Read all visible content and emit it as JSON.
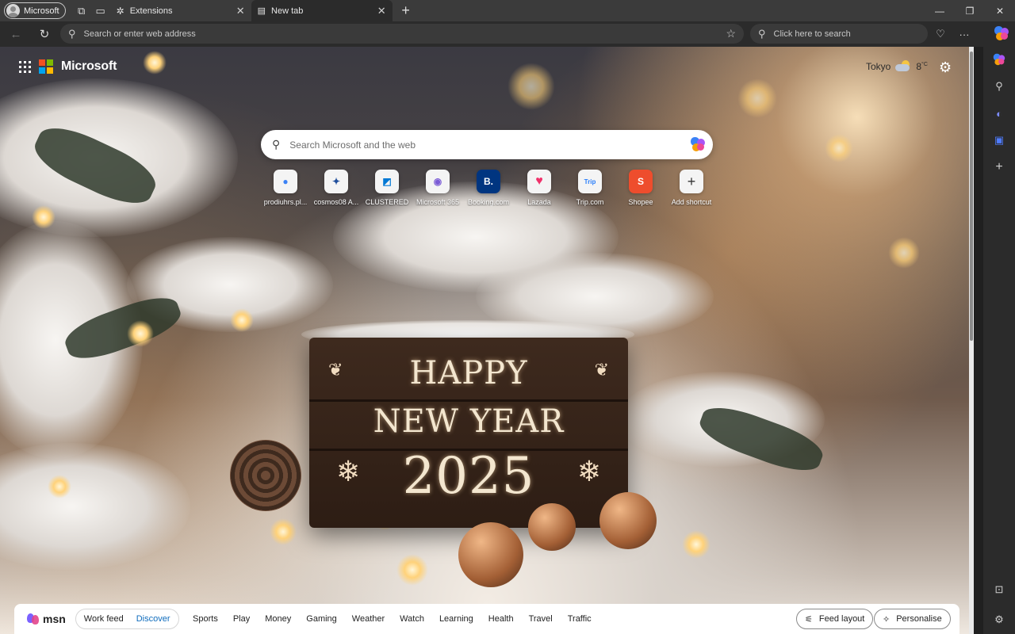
{
  "browser": {
    "profile_label": "Microsoft",
    "tabs": [
      {
        "label": "Extensions",
        "active": false
      },
      {
        "label": "New tab",
        "active": true
      }
    ],
    "address_placeholder": "Search or enter web address",
    "web_search_placeholder": "Click here to search"
  },
  "page": {
    "brand": "Microsoft",
    "weather": {
      "city": "Tokyo",
      "temp": "8",
      "unit": "°C"
    },
    "search_placeholder": "Search Microsoft and the web",
    "shortcuts": [
      {
        "label": "prodiuhrs.pl...",
        "glyph": "●",
        "color": "#3b82f6"
      },
      {
        "label": "cosmos08 A...",
        "glyph": "✦",
        "color": "#1f4e9c"
      },
      {
        "label": "CLUSTERED",
        "glyph": "◩",
        "color": "#0078d4"
      },
      {
        "label": "Microsoft 365",
        "glyph": "◉",
        "color": "#7b5cd6"
      },
      {
        "label": "Booking.com",
        "glyph": "B.",
        "color": "#003580"
      },
      {
        "label": "Lazada",
        "glyph": "♥",
        "color": "#f0316a"
      },
      {
        "label": "Trip.com",
        "glyph": "Trip",
        "color": "#287dfa"
      },
      {
        "label": "Shopee",
        "glyph": "S",
        "color": "#ee4d2d"
      },
      {
        "label": "Add shortcut",
        "glyph": "+",
        "color": "#333333"
      }
    ],
    "greeting_sign": {
      "line1": "HAPPY",
      "line2": "NEW YEAR",
      "line3": "2025"
    }
  },
  "feed": {
    "brand": "msn",
    "tabs": [
      {
        "label": "Work feed",
        "active": false
      },
      {
        "label": "Discover",
        "active": true
      }
    ],
    "links": [
      "Sports",
      "Play",
      "Money",
      "Gaming",
      "Weather",
      "Watch",
      "Learning",
      "Health",
      "Travel",
      "Traffic"
    ],
    "feed_layout_label": "Feed layout",
    "personalise_label": "Personalise"
  }
}
